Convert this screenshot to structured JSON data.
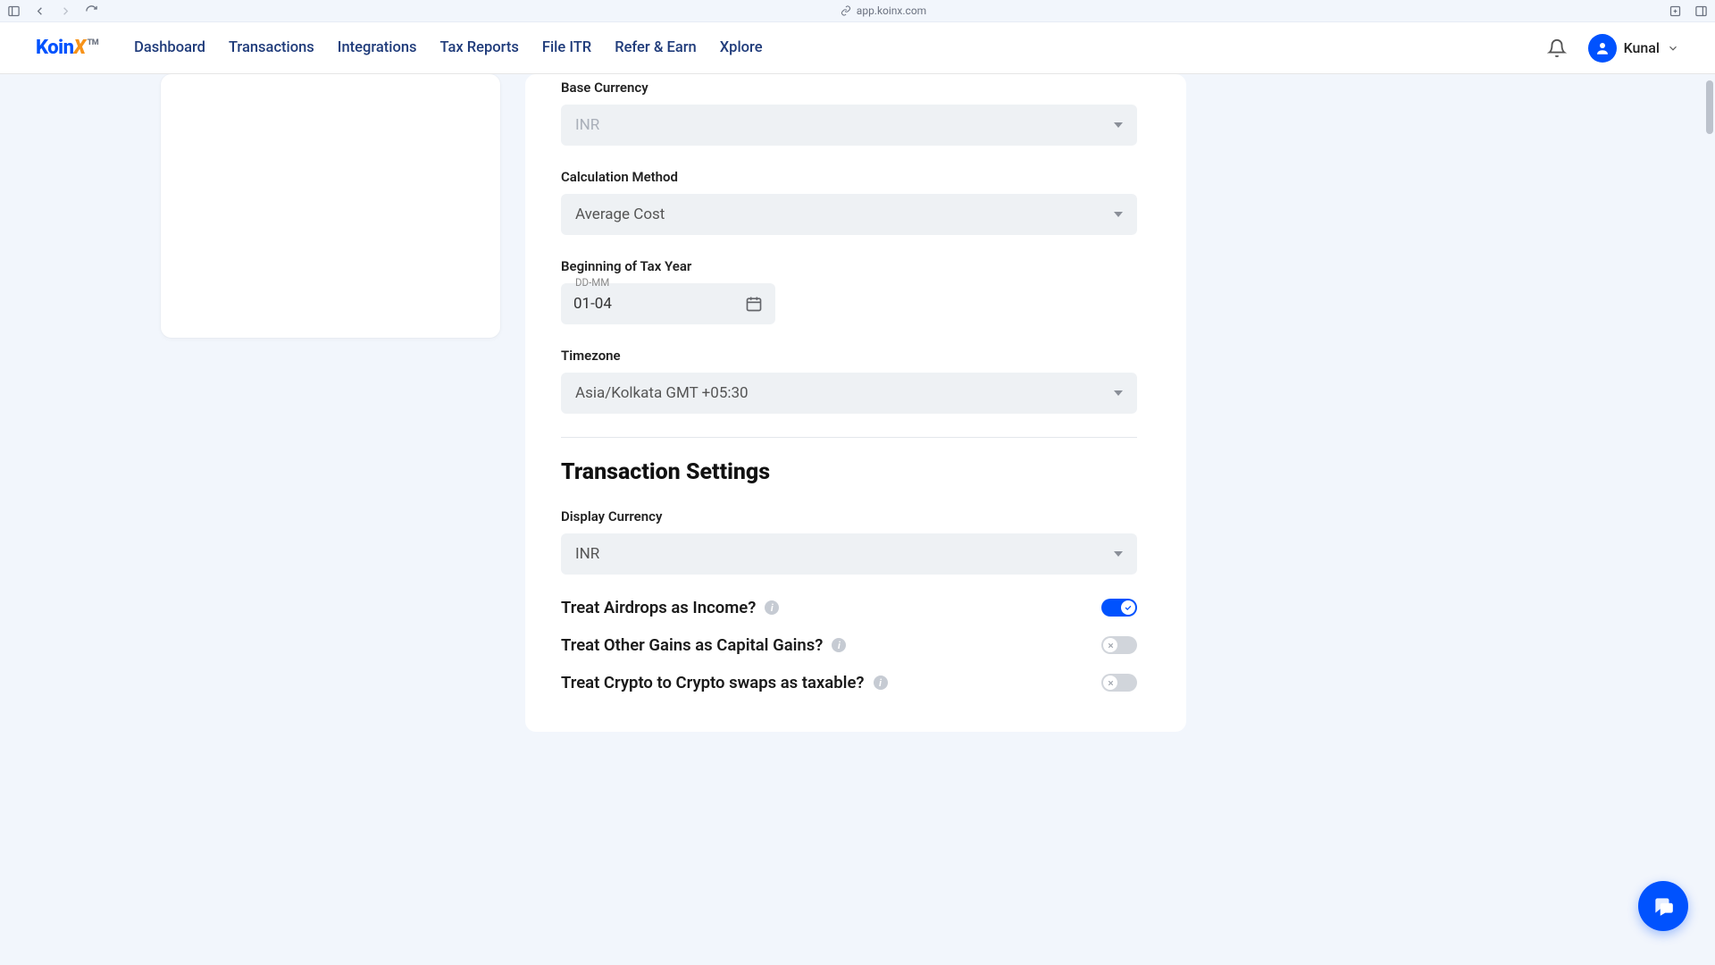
{
  "browser": {
    "url": "app.koinx.com"
  },
  "brand": {
    "name_prefix": "Koin",
    "name_suffix": "X",
    "tm": "TM"
  },
  "nav": {
    "items": [
      "Dashboard",
      "Transactions",
      "Integrations",
      "Tax Reports",
      "File ITR",
      "Refer & Earn",
      "Xplore"
    ]
  },
  "user": {
    "name": "Kunal"
  },
  "settings": {
    "base_currency": {
      "label": "Base Currency",
      "value": "INR"
    },
    "calculation_method": {
      "label": "Calculation Method",
      "value": "Average Cost"
    },
    "tax_year": {
      "label": "Beginning of Tax Year",
      "format": "DD-MM",
      "value": "01-04"
    },
    "timezone": {
      "label": "Timezone",
      "value": "Asia/Kolkata GMT +05:30"
    }
  },
  "transaction_settings": {
    "title": "Transaction Settings",
    "display_currency": {
      "label": "Display Currency",
      "value": "INR"
    },
    "toggles": {
      "airdrops": {
        "label": "Treat Airdrops as Income?",
        "on": true
      },
      "other_gains": {
        "label": "Treat Other Gains as Capital Gains?",
        "on": false
      },
      "swaps": {
        "label": "Treat Crypto to Crypto swaps as taxable?",
        "on": false
      }
    }
  }
}
